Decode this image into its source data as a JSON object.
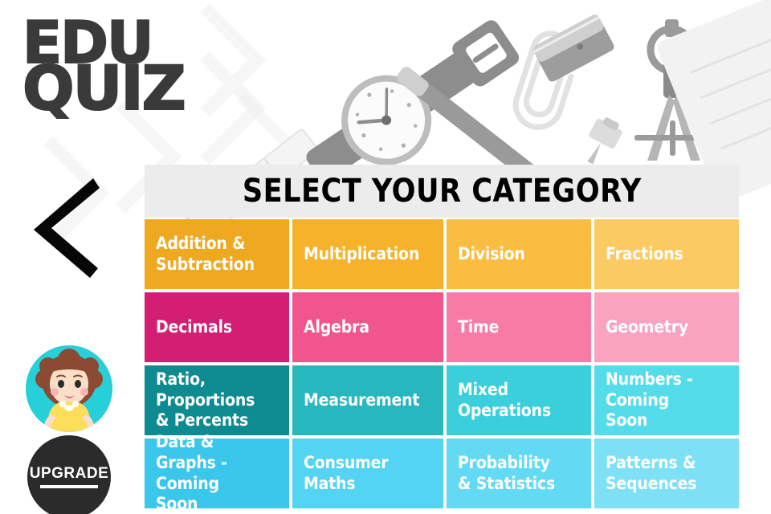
{
  "logo": {
    "line1": "EDU",
    "line2": "QUIZ"
  },
  "sidebar": {
    "back_button": {
      "name": "back-chevron",
      "icon": "chevron-left-icon"
    },
    "avatar": {
      "name": "user-avatar",
      "description": "girl-avatar",
      "bg_color": "#27CFD8",
      "hair_color": "#8B4A32",
      "shirt_color": "#FCDE5A",
      "skin_color": "#F9DEC8"
    },
    "upgrade": {
      "label": "UPGRADE",
      "bg_color": "#2b2b2b",
      "text_color": "#ffffff"
    }
  },
  "panel": {
    "title": "SELECT YOUR CATEGORY",
    "header_bg": "#ececec",
    "title_color": "#000000"
  },
  "categories": [
    {
      "label": "Addition & Subtraction",
      "color": "#EFA920",
      "row": 1,
      "col": 1
    },
    {
      "label": "Multiplication",
      "color": "#F6B22B",
      "row": 1,
      "col": 2
    },
    {
      "label": "Division",
      "color": "#F9BE41",
      "row": 1,
      "col": 3
    },
    {
      "label": "Fractions",
      "color": "#FBCA63",
      "row": 1,
      "col": 4
    },
    {
      "label": "Decimals",
      "color": "#D41E74",
      "row": 2,
      "col": 1
    },
    {
      "label": "Algebra",
      "color": "#F0568C",
      "row": 2,
      "col": 2
    },
    {
      "label": "Time",
      "color": "#F87BA5",
      "row": 2,
      "col": 3
    },
    {
      "label": "Geometry",
      "color": "#FAA3BF",
      "row": 2,
      "col": 4
    },
    {
      "label": "Ratio, Proportions & Percents",
      "color": "#0E8A91",
      "row": 3,
      "col": 1
    },
    {
      "label": "Measurement",
      "color": "#26B7BF",
      "row": 3,
      "col": 2
    },
    {
      "label": "Mixed Operations",
      "color": "#3BCEDB",
      "row": 3,
      "col": 3
    },
    {
      "label": "Numbers - Coming Soon",
      "color": "#55DCEA",
      "row": 3,
      "col": 4
    },
    {
      "label": "Data & Graphs - Coming Soon",
      "color": "#3BC6EC",
      "row": 4,
      "col": 1
    },
    {
      "label": "Consumer Maths",
      "color": "#52D4F2",
      "row": 4,
      "col": 2
    },
    {
      "label": "Probability & Statistics",
      "color": "#63DAF4",
      "row": 4,
      "col": 3
    },
    {
      "label": "Patterns & Sequences",
      "color": "#7EE0F5",
      "row": 4,
      "col": 4
    }
  ],
  "background": {
    "description": "grayscale flat-lay of stationery: wristwatch, pen, paperclip, pencil sharpener, drawing compass, pushpin, ruler, paper sheet",
    "items": [
      "wristwatch-icon",
      "pen-icon",
      "paperclip-icon",
      "sharpener-icon",
      "compass-icon",
      "pushpin-icon",
      "ruler-icon",
      "paper-sheet-icon"
    ]
  }
}
